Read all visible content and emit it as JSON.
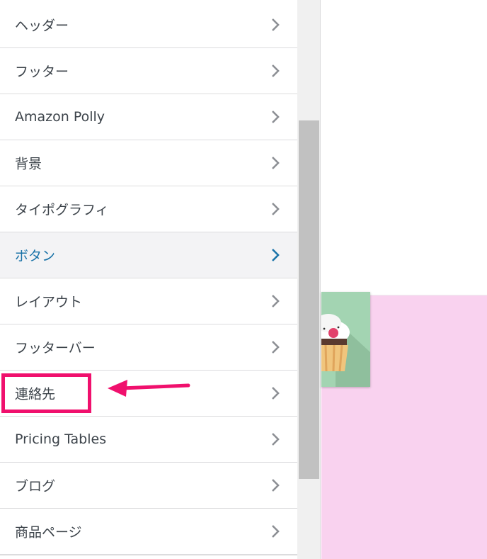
{
  "menu": {
    "items": [
      {
        "label": "ヘッダー",
        "active": false
      },
      {
        "label": "フッター",
        "active": false
      },
      {
        "label": "Amazon Polly",
        "active": false
      },
      {
        "label": "背景",
        "active": false
      },
      {
        "label": "タイポグラフィ",
        "active": false
      },
      {
        "label": "ボタン",
        "active": true
      },
      {
        "label": "レイアウト",
        "active": false
      },
      {
        "label": "フッターバー",
        "active": false
      },
      {
        "label": "連絡先",
        "active": false
      },
      {
        "label": "Pricing Tables",
        "active": false
      },
      {
        "label": "ブログ",
        "active": false
      },
      {
        "label": "商品ページ",
        "active": false
      }
    ]
  },
  "colors": {
    "accent": "#1a73a8",
    "highlight": "#f0106d",
    "preview_background": "#f9d2ef",
    "thumbnail_background": "#a3d4b2"
  },
  "icons": {
    "chevron": "chevron-right-icon",
    "annotation_arrow": "arrow-left-icon"
  }
}
